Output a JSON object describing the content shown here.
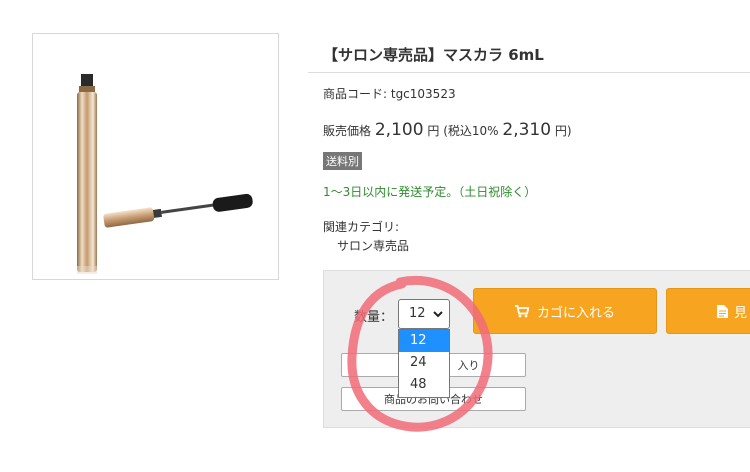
{
  "product": {
    "title": "【サロン専売品】マスカラ 6mL",
    "code": "商品コード: tgc103523",
    "price_prefix": "販売価格",
    "price_main": "2,100",
    "price_yen": "円",
    "price_tax_prefix": "(税込10%",
    "price_tax": "2,310",
    "price_tax_suffix": "円)",
    "badge": "送料別",
    "shipping_note": "1〜3日以内に発送予定。（土日祝除く）",
    "category_label": "関連カテゴリ:",
    "category_link": "サロン専売品"
  },
  "purchase": {
    "qty_label": "数量：",
    "qty_value": "12",
    "qty_options": [
      "12",
      "24",
      "48"
    ],
    "cart_button": "カゴに入れる",
    "estimate_button": "見",
    "favorite_button_visible": "入り",
    "inquiry_button": "商品のお問い合わせ"
  },
  "colors": {
    "accent": "#f7a520",
    "selected_option": "#1e90ff",
    "annotation": "#f06b78",
    "badge": "#777777",
    "ship_note": "#2e8b2e"
  },
  "icons": {
    "cart": "cart-icon",
    "estimate": "document-icon",
    "dropdown": "chevron-down-icon"
  }
}
